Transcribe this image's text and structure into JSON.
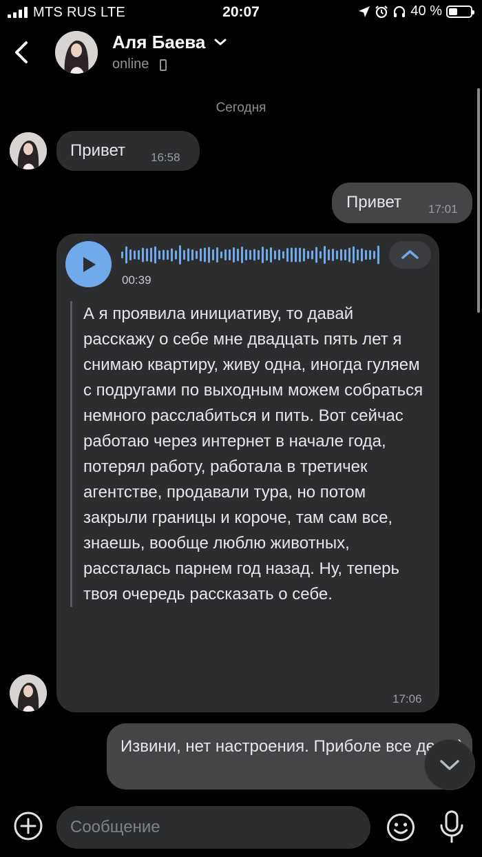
{
  "status_bar": {
    "carrier": "MTS RUS  LTE",
    "time": "20:07",
    "battery": "40 %",
    "battery_level": 0.4
  },
  "header": {
    "contact_name": "Аля Баева",
    "status": "online"
  },
  "chat": {
    "date_separator": "Сегодня",
    "messages": [
      {
        "direction": "in",
        "text": "Привет",
        "time": "16:58"
      },
      {
        "direction": "out",
        "text": "Привет",
        "time": "17:01"
      },
      {
        "direction": "in",
        "type": "voice",
        "duration": "00:39",
        "transcript": "А я проявила инициативу, то давай расскажу о себе мне двадцать пять лет я снимаю квартиру, живу одна, иногда гуляем с подругами по выходным можем собраться немного расслабиться и пить. Вот сейчас работаю через интернет в начале года, потерял работу, работала в третичек агентстве, продавали тура, но потом закрыли границы и короче, там сам все, знаешь, вообще люблю животных, рассталась парнем год назад. Ну, теперь твоя очередь рассказать о себе.",
        "time": "17:06"
      },
      {
        "direction": "out",
        "text": "Извини, нет настроения. Приболе все дела )"
      }
    ]
  },
  "composer": {
    "placeholder": "Сообщение"
  },
  "colors": {
    "background": "#000000",
    "bubble_in": "#2c2d2e",
    "bubble_out": "#444547",
    "accent": "#71aaeb"
  }
}
